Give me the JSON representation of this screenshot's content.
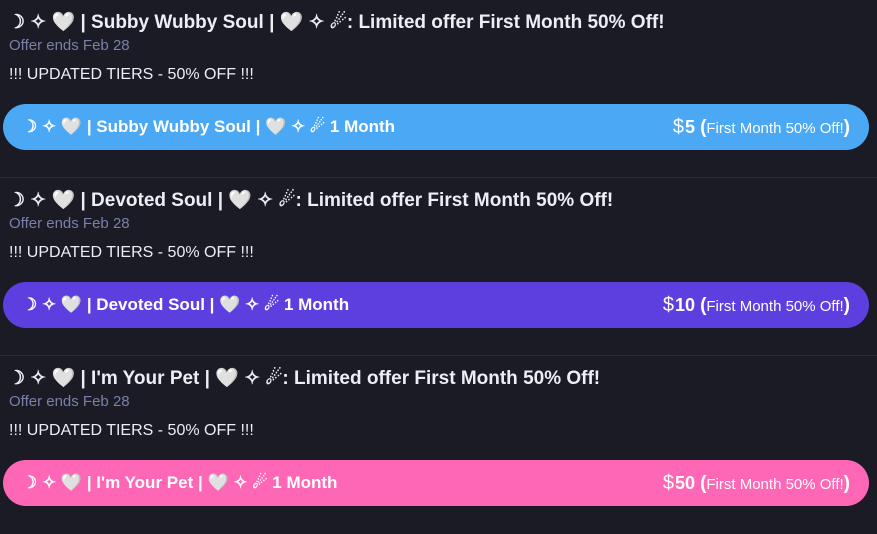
{
  "tiers": [
    {
      "title": "☽ ✧ 🤍 | Subby Wubby Soul | 🤍 ✧ ☄: Limited offer First Month 50% Off!",
      "offer_ends": "Offer ends Feb 28",
      "description": "!!! UPDATED TIERS - 50% OFF !!!",
      "button_label": "☽ ✧ 🤍 | Subby Wubby Soul | 🤍 ✧ ☄ 1 Month",
      "currency": "$",
      "price": "5",
      "price_note": "First Month 50% Off!",
      "open_paren": "(",
      "close_paren": ")",
      "color": "#4aa8f4"
    },
    {
      "title": "☽ ✧ 🤍 | Devoted Soul | 🤍 ✧ ☄: Limited offer First Month 50% Off!",
      "offer_ends": "Offer ends Feb 28",
      "description": "!!! UPDATED TIERS - 50% OFF !!!",
      "button_label": "☽ ✧ 🤍 | Devoted Soul | 🤍 ✧ ☄ 1 Month",
      "currency": "$",
      "price": "10",
      "price_note": "First Month 50% Off!",
      "open_paren": "(",
      "close_paren": ")",
      "color": "#5d3fe0"
    },
    {
      "title": "☽ ✧ 🤍 | I'm Your Pet | 🤍 ✧ ☄: Limited offer First Month 50% Off!",
      "offer_ends": "Offer ends Feb 28",
      "description": "!!! UPDATED TIERS - 50% OFF !!!",
      "button_label": "☽ ✧ 🤍 | I'm Your Pet | 🤍 ✧ ☄ 1 Month",
      "currency": "$",
      "price": "50",
      "price_note": "First Month 50% Off!",
      "open_paren": "(",
      "close_paren": ")",
      "color": "#fe66b6"
    }
  ]
}
